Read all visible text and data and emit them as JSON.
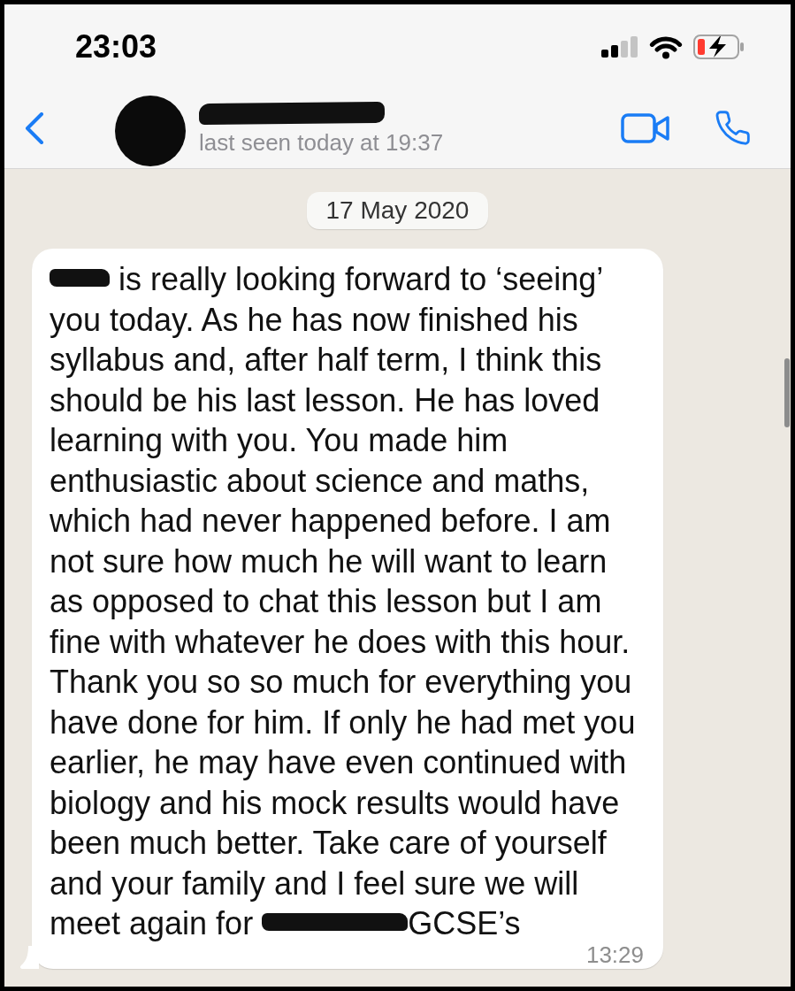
{
  "status_bar": {
    "time": "23:03",
    "charging": true
  },
  "header": {
    "avatar": {
      "kind": "redacted"
    },
    "name": {
      "kind": "redacted"
    },
    "status": "last seen today at 19:37"
  },
  "chat": {
    "date": "17 May 2020",
    "messages": [
      {
        "incoming": true,
        "segments": [
          {
            "kind": "redacted"
          },
          {
            "kind": "text",
            "text": " is really looking forward to ‘seeing’ you today. As he has now finished his syllabus and, after half term, I think this should be his last lesson. He has loved learning with you. You made him enthusiastic about science and maths, which had never happened before. I am not sure how much he will want to learn as opposed to chat this lesson but I am fine with whatever he does with this hour. Thank you so so much for everything you have done for him. If only he had met you earlier, he may have even continued with biology and his mock results would have been much better. Take care of yourself and your family and I feel sure we will meet again for "
          },
          {
            "kind": "redacted"
          },
          {
            "kind": "text",
            "text": "GCSE’s"
          }
        ],
        "time": "13:29"
      }
    ]
  }
}
